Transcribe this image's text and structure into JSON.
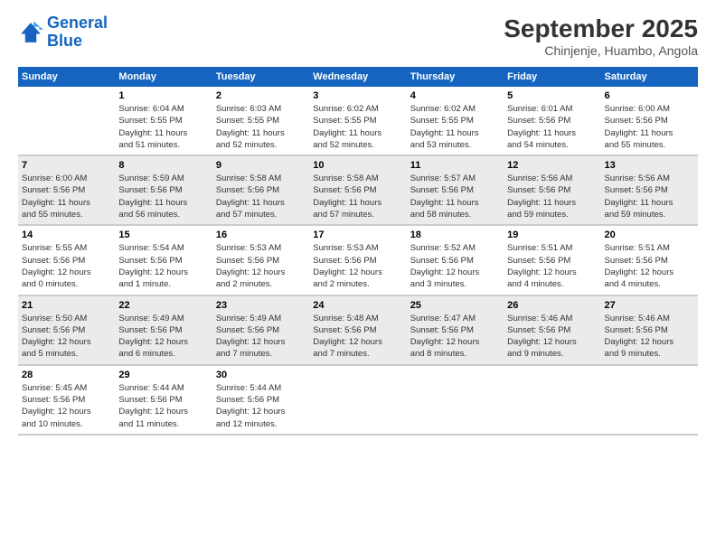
{
  "logo": {
    "line1": "General",
    "line2": "Blue"
  },
  "title": "September 2025",
  "subtitle": "Chinjenje, Huambo, Angola",
  "columns": [
    "Sunday",
    "Monday",
    "Tuesday",
    "Wednesday",
    "Thursday",
    "Friday",
    "Saturday"
  ],
  "weeks": [
    [
      {
        "num": "",
        "info": ""
      },
      {
        "num": "1",
        "info": "Sunrise: 6:04 AM\nSunset: 5:55 PM\nDaylight: 11 hours\nand 51 minutes."
      },
      {
        "num": "2",
        "info": "Sunrise: 6:03 AM\nSunset: 5:55 PM\nDaylight: 11 hours\nand 52 minutes."
      },
      {
        "num": "3",
        "info": "Sunrise: 6:02 AM\nSunset: 5:55 PM\nDaylight: 11 hours\nand 52 minutes."
      },
      {
        "num": "4",
        "info": "Sunrise: 6:02 AM\nSunset: 5:55 PM\nDaylight: 11 hours\nand 53 minutes."
      },
      {
        "num": "5",
        "info": "Sunrise: 6:01 AM\nSunset: 5:56 PM\nDaylight: 11 hours\nand 54 minutes."
      },
      {
        "num": "6",
        "info": "Sunrise: 6:00 AM\nSunset: 5:56 PM\nDaylight: 11 hours\nand 55 minutes."
      }
    ],
    [
      {
        "num": "7",
        "info": "Sunrise: 6:00 AM\nSunset: 5:56 PM\nDaylight: 11 hours\nand 55 minutes."
      },
      {
        "num": "8",
        "info": "Sunrise: 5:59 AM\nSunset: 5:56 PM\nDaylight: 11 hours\nand 56 minutes."
      },
      {
        "num": "9",
        "info": "Sunrise: 5:58 AM\nSunset: 5:56 PM\nDaylight: 11 hours\nand 57 minutes."
      },
      {
        "num": "10",
        "info": "Sunrise: 5:58 AM\nSunset: 5:56 PM\nDaylight: 11 hours\nand 57 minutes."
      },
      {
        "num": "11",
        "info": "Sunrise: 5:57 AM\nSunset: 5:56 PM\nDaylight: 11 hours\nand 58 minutes."
      },
      {
        "num": "12",
        "info": "Sunrise: 5:56 AM\nSunset: 5:56 PM\nDaylight: 11 hours\nand 59 minutes."
      },
      {
        "num": "13",
        "info": "Sunrise: 5:56 AM\nSunset: 5:56 PM\nDaylight: 11 hours\nand 59 minutes."
      }
    ],
    [
      {
        "num": "14",
        "info": "Sunrise: 5:55 AM\nSunset: 5:56 PM\nDaylight: 12 hours\nand 0 minutes."
      },
      {
        "num": "15",
        "info": "Sunrise: 5:54 AM\nSunset: 5:56 PM\nDaylight: 12 hours\nand 1 minute."
      },
      {
        "num": "16",
        "info": "Sunrise: 5:53 AM\nSunset: 5:56 PM\nDaylight: 12 hours\nand 2 minutes."
      },
      {
        "num": "17",
        "info": "Sunrise: 5:53 AM\nSunset: 5:56 PM\nDaylight: 12 hours\nand 2 minutes."
      },
      {
        "num": "18",
        "info": "Sunrise: 5:52 AM\nSunset: 5:56 PM\nDaylight: 12 hours\nand 3 minutes."
      },
      {
        "num": "19",
        "info": "Sunrise: 5:51 AM\nSunset: 5:56 PM\nDaylight: 12 hours\nand 4 minutes."
      },
      {
        "num": "20",
        "info": "Sunrise: 5:51 AM\nSunset: 5:56 PM\nDaylight: 12 hours\nand 4 minutes."
      }
    ],
    [
      {
        "num": "21",
        "info": "Sunrise: 5:50 AM\nSunset: 5:56 PM\nDaylight: 12 hours\nand 5 minutes."
      },
      {
        "num": "22",
        "info": "Sunrise: 5:49 AM\nSunset: 5:56 PM\nDaylight: 12 hours\nand 6 minutes."
      },
      {
        "num": "23",
        "info": "Sunrise: 5:49 AM\nSunset: 5:56 PM\nDaylight: 12 hours\nand 7 minutes."
      },
      {
        "num": "24",
        "info": "Sunrise: 5:48 AM\nSunset: 5:56 PM\nDaylight: 12 hours\nand 7 minutes."
      },
      {
        "num": "25",
        "info": "Sunrise: 5:47 AM\nSunset: 5:56 PM\nDaylight: 12 hours\nand 8 minutes."
      },
      {
        "num": "26",
        "info": "Sunrise: 5:46 AM\nSunset: 5:56 PM\nDaylight: 12 hours\nand 9 minutes."
      },
      {
        "num": "27",
        "info": "Sunrise: 5:46 AM\nSunset: 5:56 PM\nDaylight: 12 hours\nand 9 minutes."
      }
    ],
    [
      {
        "num": "28",
        "info": "Sunrise: 5:45 AM\nSunset: 5:56 PM\nDaylight: 12 hours\nand 10 minutes."
      },
      {
        "num": "29",
        "info": "Sunrise: 5:44 AM\nSunset: 5:56 PM\nDaylight: 12 hours\nand 11 minutes."
      },
      {
        "num": "30",
        "info": "Sunrise: 5:44 AM\nSunset: 5:56 PM\nDaylight: 12 hours\nand 12 minutes."
      },
      {
        "num": "",
        "info": ""
      },
      {
        "num": "",
        "info": ""
      },
      {
        "num": "",
        "info": ""
      },
      {
        "num": "",
        "info": ""
      }
    ]
  ]
}
